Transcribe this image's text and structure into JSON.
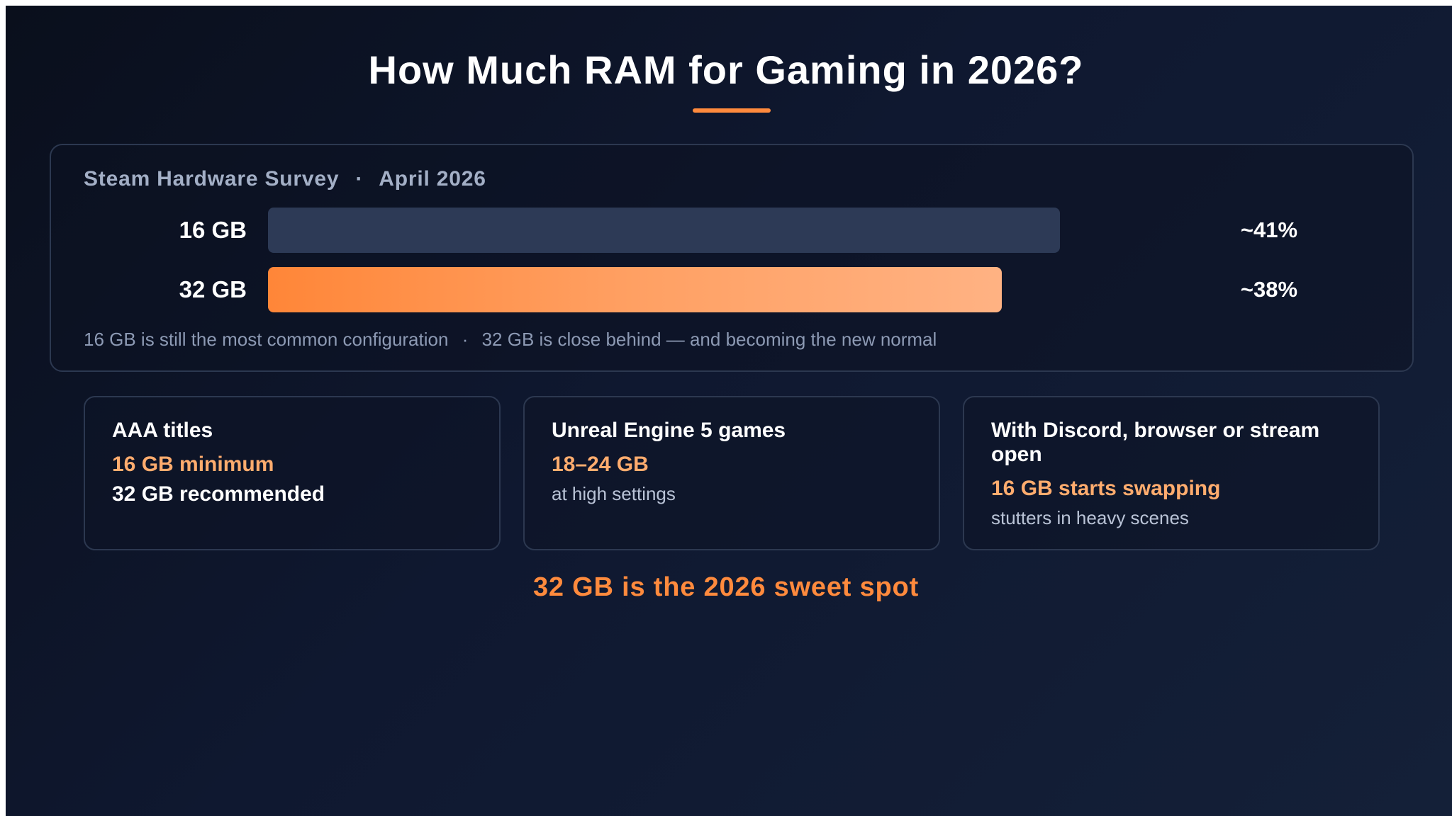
{
  "title": "How Much RAM for Gaming in 2026?",
  "survey": {
    "source": "Steam Hardware Survey",
    "separator": "·",
    "date": "April 2026",
    "note_left": "16 GB is still the most common configuration",
    "note_sep": "·",
    "note_right": "32 GB is close behind — and becoming the new normal"
  },
  "chart_data": {
    "type": "bar",
    "orientation": "horizontal",
    "categories": [
      "16 GB",
      "32 GB"
    ],
    "values": [
      41,
      38
    ],
    "value_labels": [
      "~41%",
      "~38%"
    ],
    "unit": "%",
    "title": "Steam Hardware Survey · April 2026",
    "xlim": [
      0,
      53.6
    ],
    "colors": [
      "#2d3a56",
      "#ff8a3d"
    ],
    "grid": false
  },
  "cards": [
    {
      "title": "AAA titles",
      "highlight": "16 GB minimum",
      "detail_strong": "32 GB recommended",
      "detail": ""
    },
    {
      "title": "Unreal Engine 5 games",
      "highlight": "18–24 GB",
      "detail_strong": "",
      "detail": "at high settings"
    },
    {
      "title": "With Discord, browser or stream open",
      "highlight": "16 GB starts swapping",
      "detail_strong": "",
      "detail": "stutters in heavy scenes"
    }
  ],
  "conclusion": "32 GB is the 2026 sweet spot",
  "colors": {
    "accent": "#ff8a3d",
    "accent_light": "#ffac6e",
    "muted_bar": "#2d3a56",
    "background": "#0f1830"
  }
}
